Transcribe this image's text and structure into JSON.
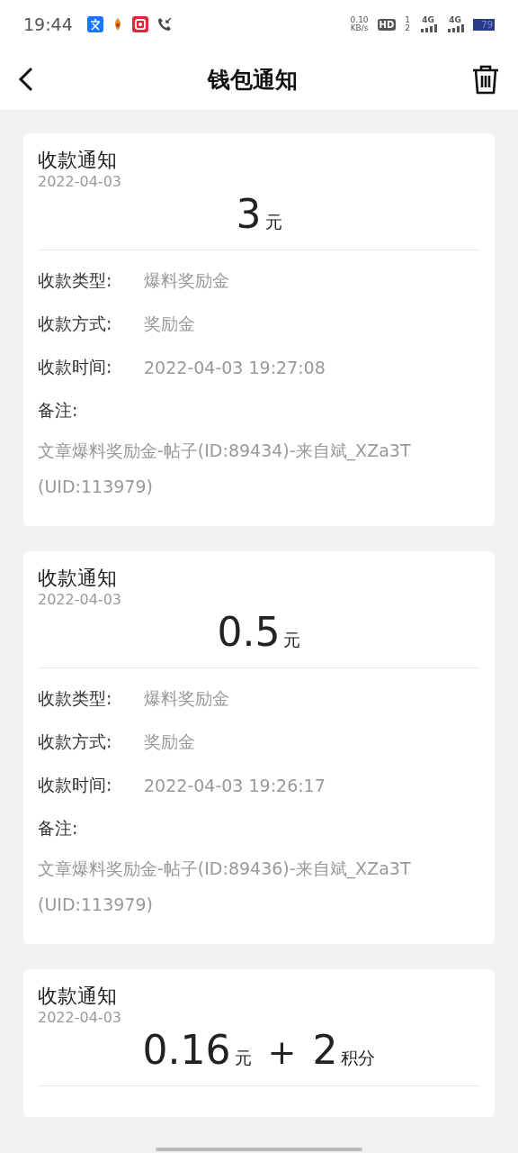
{
  "status_bar": {
    "time": "19:44",
    "speed": "0.10",
    "speed_unit": "KB/s",
    "hd": "HD",
    "sim_1": "1",
    "sim_2": "2",
    "network_1": "4G",
    "network_2": "4G",
    "battery": "79"
  },
  "header": {
    "title": "钱包通知"
  },
  "notices": [
    {
      "title": "收款通知",
      "date": "2022-04-03",
      "amount": [
        {
          "kind": "number",
          "text": "3"
        },
        {
          "kind": "unit",
          "text": "元"
        }
      ],
      "fields": [
        {
          "label": "收款类型:",
          "value": "爆料奖励金"
        },
        {
          "label": "收款方式:",
          "value": "奖励金"
        },
        {
          "label": "收款时间:",
          "value": "2022-04-03 19:27:08"
        }
      ],
      "remark_label": "备注:",
      "remark": "文章爆料奖励金-帖子(ID:89434)-来自斌_XZa3T (UID:113979)"
    },
    {
      "title": "收款通知",
      "date": "2022-04-03",
      "amount": [
        {
          "kind": "number",
          "text": "0.5"
        },
        {
          "kind": "unit",
          "text": "元"
        }
      ],
      "fields": [
        {
          "label": "收款类型:",
          "value": "爆料奖励金"
        },
        {
          "label": "收款方式:",
          "value": "奖励金"
        },
        {
          "label": "收款时间:",
          "value": "2022-04-03 19:26:17"
        }
      ],
      "remark_label": "备注:",
      "remark": "文章爆料奖励金-帖子(ID:89436)-来自斌_XZa3T (UID:113979)"
    },
    {
      "title": "收款通知",
      "date": "2022-04-03",
      "amount": [
        {
          "kind": "number",
          "text": "0.16"
        },
        {
          "kind": "unit",
          "text": "元"
        },
        {
          "kind": "plus",
          "text": "+"
        },
        {
          "kind": "number",
          "text": "2"
        },
        {
          "kind": "unit",
          "text": "积分"
        }
      ]
    }
  ]
}
